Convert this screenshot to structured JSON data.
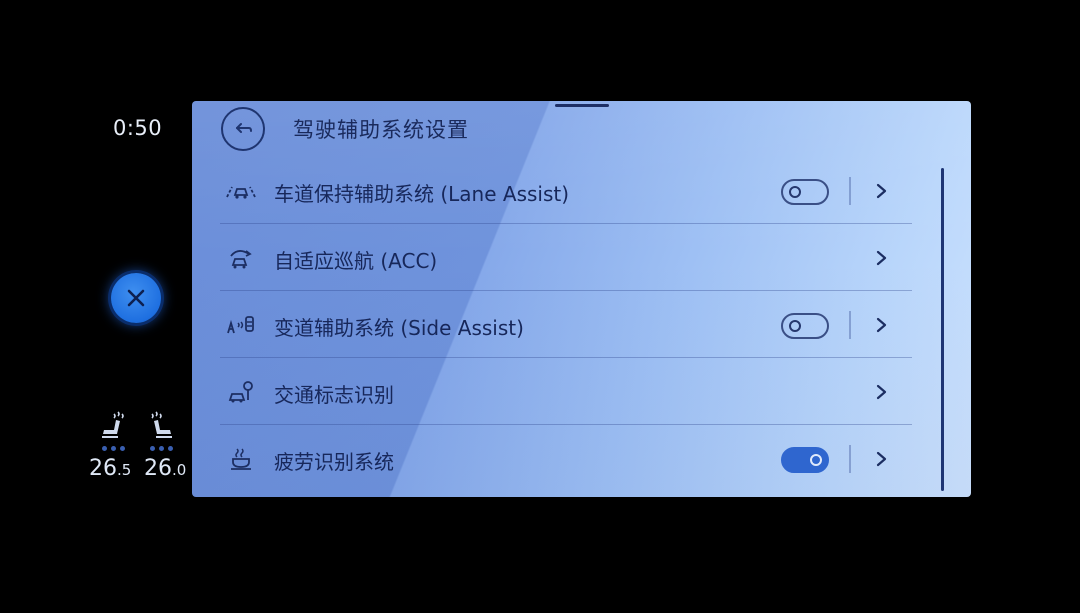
{
  "status": {
    "clock": "0:50",
    "temp_left": {
      "main": "26",
      "dec": ".5"
    },
    "temp_right": {
      "main": "26",
      "dec": ".0"
    }
  },
  "header": {
    "title": "驾驶辅助系统设置"
  },
  "rows": [
    {
      "icon": "lane-assist-icon",
      "label": "车道保持辅助系统 (Lane Assist)",
      "toggle": "off",
      "chevron": true
    },
    {
      "icon": "acc-icon",
      "label": "自适应巡航 (ACC)",
      "toggle": null,
      "chevron": true
    },
    {
      "icon": "side-assist-icon",
      "label": "变道辅助系统 (Side Assist)",
      "toggle": "off",
      "chevron": true
    },
    {
      "icon": "traffic-sign-icon",
      "label": "交通标志识别",
      "toggle": null,
      "chevron": true
    },
    {
      "icon": "coffee-cup-icon",
      "label": "疲劳识别系统",
      "toggle": "on",
      "chevron": true
    }
  ],
  "colors": {
    "accent": "#2f66cf",
    "close_button": "#1e6fe0",
    "text": "#17275a"
  }
}
